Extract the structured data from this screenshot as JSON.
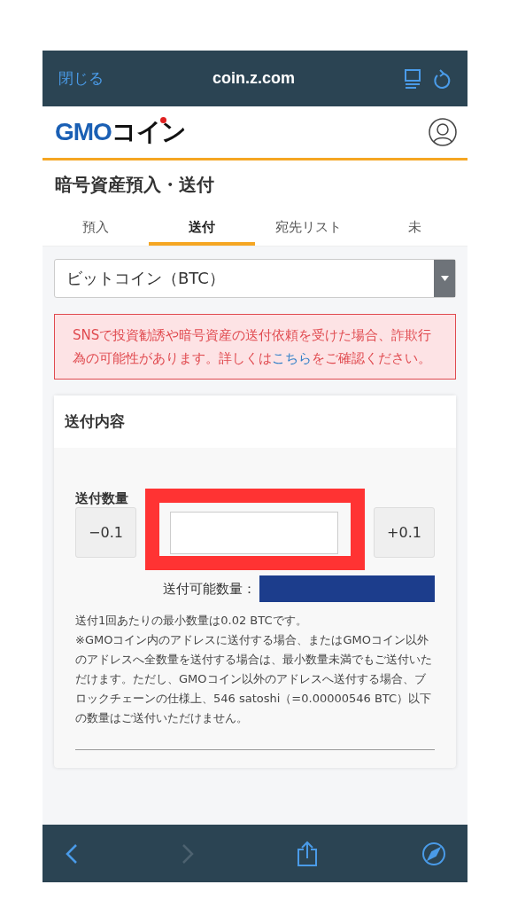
{
  "browser_bar": {
    "close": "閉じる",
    "url": "coin.z.com"
  },
  "logo": {
    "latin": "GMO",
    "kana": "コイン"
  },
  "page_title": "暗号資産預入・送付",
  "tabs": [
    {
      "label": "預入",
      "selected": false
    },
    {
      "label": "送付",
      "selected": true
    },
    {
      "label": "宛先リスト",
      "selected": false
    },
    {
      "label": "未",
      "selected": false
    }
  ],
  "currency_select": {
    "value": "ビットコイン（BTC）"
  },
  "alert": {
    "text_before": "SNSで投資勧誘や暗号資産の送付依頼を受けた場合、詐欺行為の可能性があります。詳しくは",
    "link": "こちら",
    "text_after": "をご確認ください。"
  },
  "card": {
    "title": "送付内容",
    "amount_label": "送付数量",
    "minus_button": "−0.1",
    "plus_button": "+0.1",
    "available_label": "送付可能数量：",
    "note_lines": [
      "送付1回あたりの最小数量は0.02 BTCです。",
      "※GMOコイン内のアドレスに送付する場合、またはGMOコイン以外のアドレスへ全数量を送付する場合は、最小数量未満でもご送付いただけます。ただし、GMOコイン以外のアドレスへ送付する場合、ブロックチェーンの仕様上、546 satoshi（=0.00000546 BTC）以下の数量はご送付いただけません。"
    ]
  }
}
